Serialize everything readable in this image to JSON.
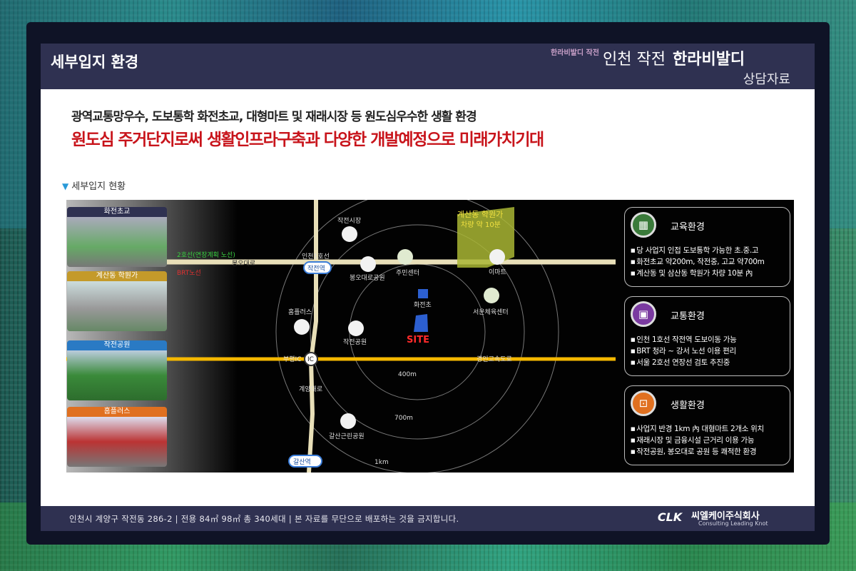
{
  "header": {
    "title": "세부입지 환경",
    "brand_logo_text": "한라비발디 작전",
    "brand_location": "인천 작전",
    "brand_name": "한라비발디",
    "subtitle": "상담자료"
  },
  "tagline_1": "광역교통망우수, 도보통학 화전초교, 대형마트 및 재래시장 등 원도심우수한 생활 환경",
  "tagline_2": "원도심 주거단지로써 생활인프라구축과 다양한 개발예정으로 미래가치기대",
  "section_title": "세부입지 현황",
  "photos": [
    {
      "caption": "화전초교"
    },
    {
      "caption": "계산동 학원가"
    },
    {
      "caption": "작전공원"
    },
    {
      "caption": "홈플러스"
    }
  ],
  "map": {
    "line2_label": "2호선(연장계획 노선)",
    "brt_label": "BRT노선",
    "academy_label": "계산동 학원가",
    "academy_sub": "차량 약 10분",
    "site_label": "SITE",
    "ring_400": "400m",
    "ring_700": "700m",
    "ring_1k": "1km",
    "station_jakjeon": "작전역",
    "station_galsan": "갈산역",
    "ic_label": "IC",
    "roads": {
      "incheon_line": "인천1호선",
      "bongo_daero": "봉오대로",
      "bupyeong_ic": "부평IC",
      "gyeongin_expressway": "경인고속도로",
      "gyeyang_daero": "계양대로"
    },
    "pois": {
      "market": "작전시장",
      "bongo_park": "봉오대로공원",
      "community_center": "주민센터",
      "emart": "이마트",
      "school": "화전초",
      "seoun_center": "서운체육센터",
      "homeplus": "홈플러스",
      "jakjeon_park": "작전공원",
      "galsan_park": "갈산근린공원"
    }
  },
  "panels": [
    {
      "title": "교육환경",
      "icon": "school-icon",
      "color": "#3a7a3a",
      "items": [
        "당 사업지 인접 도보통학 가능한 초.중.고",
        "화전초교 약200m, 작전중, 고교 약700m",
        "계산동 및 삼산동 학원가 차량 10분 內"
      ]
    },
    {
      "title": "교통환경",
      "icon": "train-icon",
      "color": "#7a3aa0",
      "items": [
        "인천 1호선 작전역 도보이동 가능",
        "BRT 청라 ~ 강서 노선 이용 편리",
        "서울 2호선 연장선 검토 추진중"
      ]
    },
    {
      "title": "생활환경",
      "icon": "cart-icon",
      "color": "#e07020",
      "items": [
        "사업지 반경 1km 內 대형마트 2개소 위치",
        "재래시장 및 금융시설 근거리 이용 가능",
        "작전공원, 봉오대로 공원 등 쾌적한 환경"
      ]
    }
  ],
  "footer": {
    "text": "인천시 계양구 작전동 286-2 | 전용 84㎡ 98㎡ 총 340세대 | 본 자료를 무단으로 배포하는 것을 금지합니다.",
    "company_logo": "CLK",
    "company_name": "씨엘케이주식회사",
    "company_sub": "Consulting Leading Knot"
  },
  "colors": {
    "header_bg": "#2f3151",
    "accent_red": "#c8141b",
    "route_yellow": "#f5b800",
    "route_cream": "#e8dfb8"
  }
}
